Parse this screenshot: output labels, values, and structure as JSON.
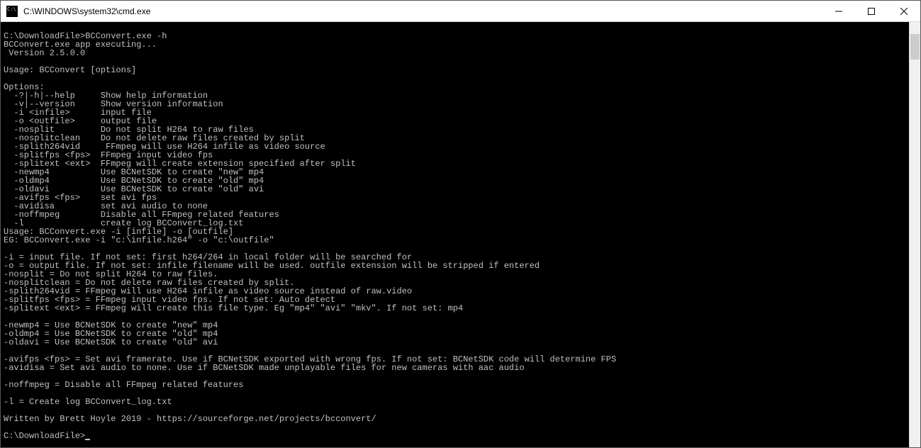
{
  "window": {
    "title": "C:\\WINDOWS\\system32\\cmd.exe"
  },
  "terminal": {
    "lines": [
      "",
      "C:\\DownloadFile>BCConvert.exe -h",
      "BCConvert.exe app executing...",
      " Version 2.5.0.0",
      "",
      "Usage: BCConvert [options]",
      "",
      "Options:",
      "  -?|-h|--help     Show help information",
      "  -v|--version     Show version information",
      "  -i <infile>      input file",
      "  -o <outfile>     output file",
      "  -nosplit         Do not split H264 to raw files",
      "  -nosplitclean    Do not delete raw files created by split",
      "  -splith264vid     FFmpeg will use H264 infile as video source",
      "  -splitfps <fps>  FFmpeg input video fps",
      "  -splitext <ext>  FFmpeg will create extension specified after split",
      "  -newmp4          Use BCNetSDK to create \"new\" mp4",
      "  -oldmp4          Use BCNetSDK to create \"old\" mp4",
      "  -oldavi          Use BCNetSDK to create \"old\" avi",
      "  -avifps <fps>    set avi fps",
      "  -avidisa         set avi audio to none",
      "  -noffmpeg        Disable all FFmpeg related features",
      "  -l               create log BCConvert_log.txt",
      "Usage: BCConvert.exe -i [infile] -o [outfile]",
      "EG: BCConvert.exe -i \"c:\\infile.h264\" -o \"c:\\outfile\"",
      "",
      "-i = input file. If not set: first h264/264 in local folder will be searched for",
      "-o = output file. If not set: infile filename will be used. outfile extension will be stripped if entered",
      "-nosplit = Do not split H264 to raw files.",
      "-nosplitclean = Do not delete raw files created by split.",
      "-splith264vid = FFmpeg will use H264 infile as video source instead of raw.video",
      "-splitfps <fps> = FFmpeg input video fps. If not set: Auto detect",
      "-splitext <ext> = FFmpeg will create this file type. Eg \"mp4\" \"avi\" \"mkv\". If not set: mp4",
      "",
      "-newmp4 = Use BCNetSDK to create \"new\" mp4",
      "-oldmp4 = Use BCNetSDK to create \"old\" mp4",
      "-oldavi = Use BCNetSDK to create \"old\" avi",
      "",
      "-avifps <fps> = Set avi framerate. Use if BCNetSDK exported with wrong fps. If not set: BCNetSDK code will determine FPS",
      "-avidisa = Set avi audio to none. Use if BCNetSDK made unplayable files for new cameras with aac audio",
      "",
      "-noffmpeg = Disable all FFmpeg related features",
      "",
      "-l = Create log BCConvert_log.txt",
      "",
      "Written by Brett Hoyle 2019 - https://sourceforge.net/projects/bcconvert/",
      "",
      "C:\\DownloadFile>"
    ]
  }
}
